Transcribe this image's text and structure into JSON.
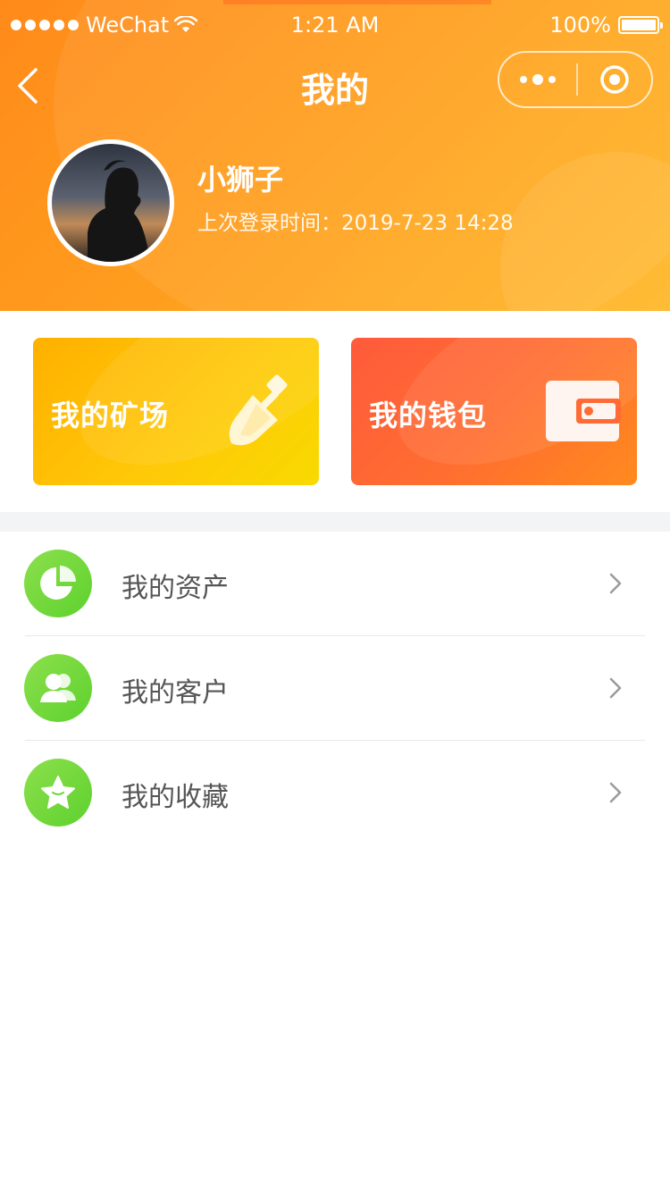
{
  "status_bar": {
    "carrier": "WeChat",
    "time": "1:21 AM",
    "battery": "100%"
  },
  "nav": {
    "title": "我的",
    "icons": [
      "back-icon",
      "more-icon",
      "close-target-icon"
    ]
  },
  "profile": {
    "username": "小狮子",
    "last_login": "上次登录时间：2019-7-23 14:28"
  },
  "cards": [
    {
      "label": "我的矿场",
      "icon": "shovel-icon"
    },
    {
      "label": "我的钱包",
      "icon": "wallet-icon"
    }
  ],
  "menu": [
    {
      "label": "我的资产",
      "icon": "pie-chart-icon"
    },
    {
      "label": "我的客户",
      "icon": "users-icon"
    },
    {
      "label": "我的收藏",
      "icon": "star-icon"
    }
  ],
  "colors": {
    "header_start": "#ff8a1a",
    "header_end": "#ffb724",
    "mine_card": "#ffc808",
    "wallet_card": "#ff6f2f",
    "menu_icon_green": "#6fd838"
  }
}
